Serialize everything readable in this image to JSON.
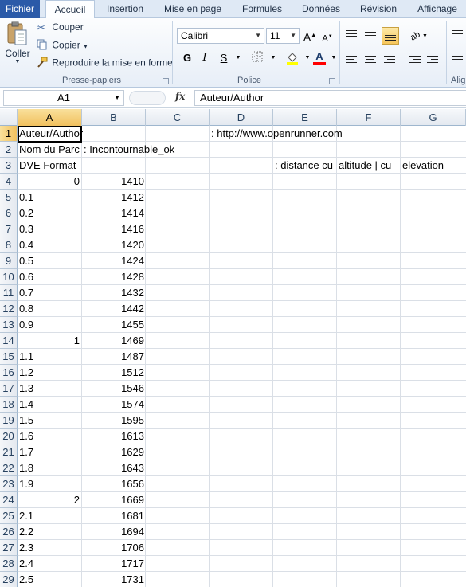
{
  "tabs": [
    "Fichier",
    "Accueil",
    "Insertion",
    "Mise en page",
    "Formules",
    "Données",
    "Révision",
    "Affichage"
  ],
  "ribbon": {
    "clipboard": {
      "paste": "Coller",
      "cut": "Couper",
      "copy": "Copier",
      "format_painter": "Reproduire la mise en forme",
      "label": "Presse-papiers"
    },
    "font": {
      "name": "Calibri",
      "size": "11",
      "label": "Police",
      "bold": "G",
      "italic": "I",
      "underline": "S",
      "grow": "A",
      "shrink": "A",
      "font_color": "A"
    },
    "alignment": {
      "label": "Alig"
    }
  },
  "formula_bar": {
    "cell_ref": "A1",
    "fx": "fx",
    "content": "Auteur/Author"
  },
  "columns": [
    "A",
    "B",
    "C",
    "D",
    "E",
    "F",
    "G"
  ],
  "rows": [
    {
      "n": "1",
      "a": "Auteur/Author",
      "b": "",
      "d": ": http://www.openrunner.com"
    },
    {
      "n": "2",
      "a": "Nom du Parc",
      "b": ": Incontournable_ok"
    },
    {
      "n": "3",
      "a": "DVE Format",
      "e": ": distance cu",
      "f": "altitude | cu",
      "g": "elevation"
    },
    {
      "n": "4",
      "a": "0",
      "a_num": true,
      "b": "1410"
    },
    {
      "n": "5",
      "a": "0.1",
      "b": "1412"
    },
    {
      "n": "6",
      "a": "0.2",
      "b": "1414"
    },
    {
      "n": "7",
      "a": "0.3",
      "b": "1416"
    },
    {
      "n": "8",
      "a": "0.4",
      "b": "1420"
    },
    {
      "n": "9",
      "a": "0.5",
      "b": "1424"
    },
    {
      "n": "10",
      "a": "0.6",
      "b": "1428"
    },
    {
      "n": "11",
      "a": "0.7",
      "b": "1432"
    },
    {
      "n": "12",
      "a": "0.8",
      "b": "1442"
    },
    {
      "n": "13",
      "a": "0.9",
      "b": "1455"
    },
    {
      "n": "14",
      "a": "1",
      "a_num": true,
      "b": "1469"
    },
    {
      "n": "15",
      "a": "1.1",
      "b": "1487"
    },
    {
      "n": "16",
      "a": "1.2",
      "b": "1512"
    },
    {
      "n": "17",
      "a": "1.3",
      "b": "1546"
    },
    {
      "n": "18",
      "a": "1.4",
      "b": "1574"
    },
    {
      "n": "19",
      "a": "1.5",
      "b": "1595"
    },
    {
      "n": "20",
      "a": "1.6",
      "b": "1613"
    },
    {
      "n": "21",
      "a": "1.7",
      "b": "1629"
    },
    {
      "n": "22",
      "a": "1.8",
      "b": "1643"
    },
    {
      "n": "23",
      "a": "1.9",
      "b": "1656"
    },
    {
      "n": "24",
      "a": "2",
      "a_num": true,
      "b": "1669"
    },
    {
      "n": "25",
      "a": "2.1",
      "b": "1681"
    },
    {
      "n": "26",
      "a": "2.2",
      "b": "1694"
    },
    {
      "n": "27",
      "a": "2.3",
      "b": "1706"
    },
    {
      "n": "28",
      "a": "2.4",
      "b": "1717"
    },
    {
      "n": "29",
      "a": "2.5",
      "b": "1731"
    }
  ],
  "colors": {
    "file_tab": "#2b5aa8",
    "selection_header": "#f1c15f",
    "font_color_bar": "#ff0000",
    "highlight_bar": "#ffff00"
  }
}
